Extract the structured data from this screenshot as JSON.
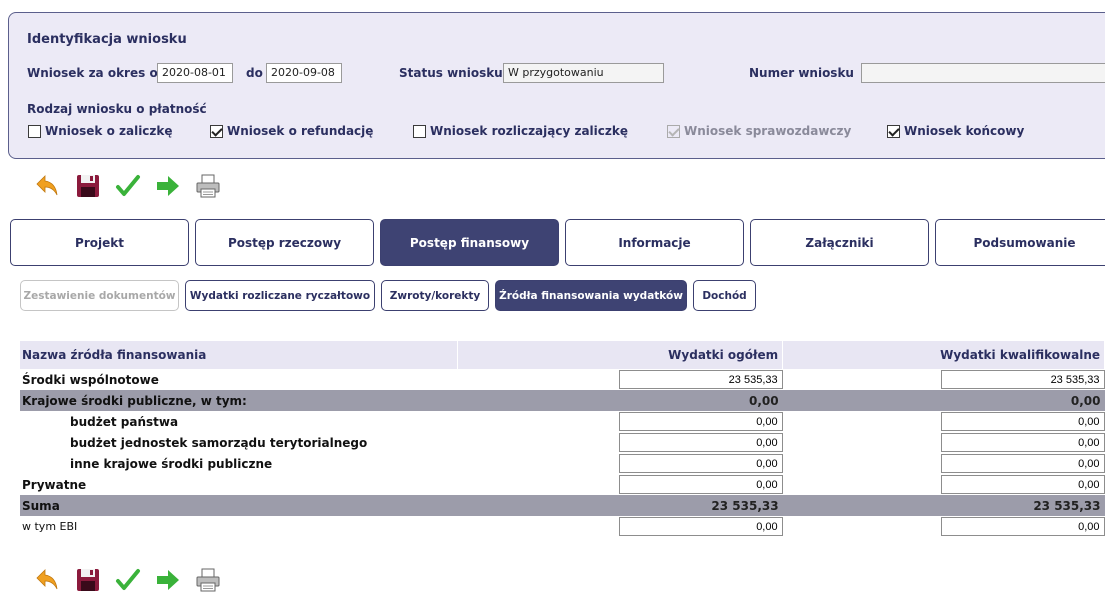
{
  "identification": {
    "title": "Identyfikacja wniosku",
    "period_from_label": "Wniosek za okres od",
    "period_from": "2020-08-01",
    "period_to_label": "do",
    "period_to": "2020-09-08",
    "status_label": "Status wniosku",
    "status_value": "W przygotowaniu",
    "number_label": "Numer wniosku",
    "number_value": "",
    "type_label": "Rodzaj wniosku o płatność",
    "types": [
      {
        "label": "Wniosek o zaliczkę",
        "checked": false,
        "disabled": false
      },
      {
        "label": "Wniosek o refundację",
        "checked": true,
        "disabled": false
      },
      {
        "label": "Wniosek rozliczający zaliczkę",
        "checked": false,
        "disabled": false
      },
      {
        "label": "Wniosek sprawozdawczy",
        "checked": true,
        "disabled": true
      },
      {
        "label": "Wniosek końcowy",
        "checked": true,
        "disabled": false
      }
    ]
  },
  "toolbar": {
    "icons": [
      "back-arrow-icon",
      "save-disk-icon",
      "checkmark-icon",
      "forward-arrow-icon",
      "printer-icon"
    ]
  },
  "main_tabs": [
    {
      "label": "Projekt",
      "active": false
    },
    {
      "label": "Postęp rzeczowy",
      "active": false
    },
    {
      "label": "Postęp finansowy",
      "active": true
    },
    {
      "label": "Informacje",
      "active": false
    },
    {
      "label": "Załączniki",
      "active": false
    },
    {
      "label": "Podsumowanie",
      "active": false
    }
  ],
  "sub_tabs": [
    {
      "label": "Zestawienie dokumentów",
      "state": "disabled"
    },
    {
      "label": "Wydatki rozliczane ryczałtowo",
      "state": "normal"
    },
    {
      "label": "Zwroty/korekty",
      "state": "normal"
    },
    {
      "label": "Źródła finansowania wydatków",
      "state": "active"
    },
    {
      "label": "Dochód",
      "state": "normal"
    }
  ],
  "table": {
    "headers": [
      "Nazwa źródła finansowania",
      "Wydatki ogółem",
      "Wydatki kwalifikowalne"
    ],
    "rows": [
      {
        "name": "Środki wspólnotowe",
        "total": "23 535,33",
        "eligible": "23 535,33"
      },
      {
        "name": "Krajowe środki publiczne, w tym:",
        "total": "0,00",
        "eligible": "0,00"
      },
      {
        "name": "budżet państwa",
        "total": "0,00",
        "eligible": "0,00"
      },
      {
        "name": "budżet jednostek samorządu terytorialnego",
        "total": "0,00",
        "eligible": "0,00"
      },
      {
        "name": "inne krajowe środki publiczne",
        "total": "0,00",
        "eligible": "0,00"
      },
      {
        "name": "Prywatne",
        "total": "0,00",
        "eligible": "0,00"
      },
      {
        "name": "Suma",
        "total": "23 535,33",
        "eligible": "23 535,33"
      },
      {
        "name": "w tym EBI",
        "total": "0,00",
        "eligible": "0,00"
      }
    ]
  },
  "colors": {
    "accent": "#3e4373",
    "panel_bg": "#eceaf6",
    "header_bg": "#e8e6f3",
    "summary_row": "#9c9caa",
    "arrow_orange": "#f0a020",
    "check_green": "#3ab23a"
  }
}
